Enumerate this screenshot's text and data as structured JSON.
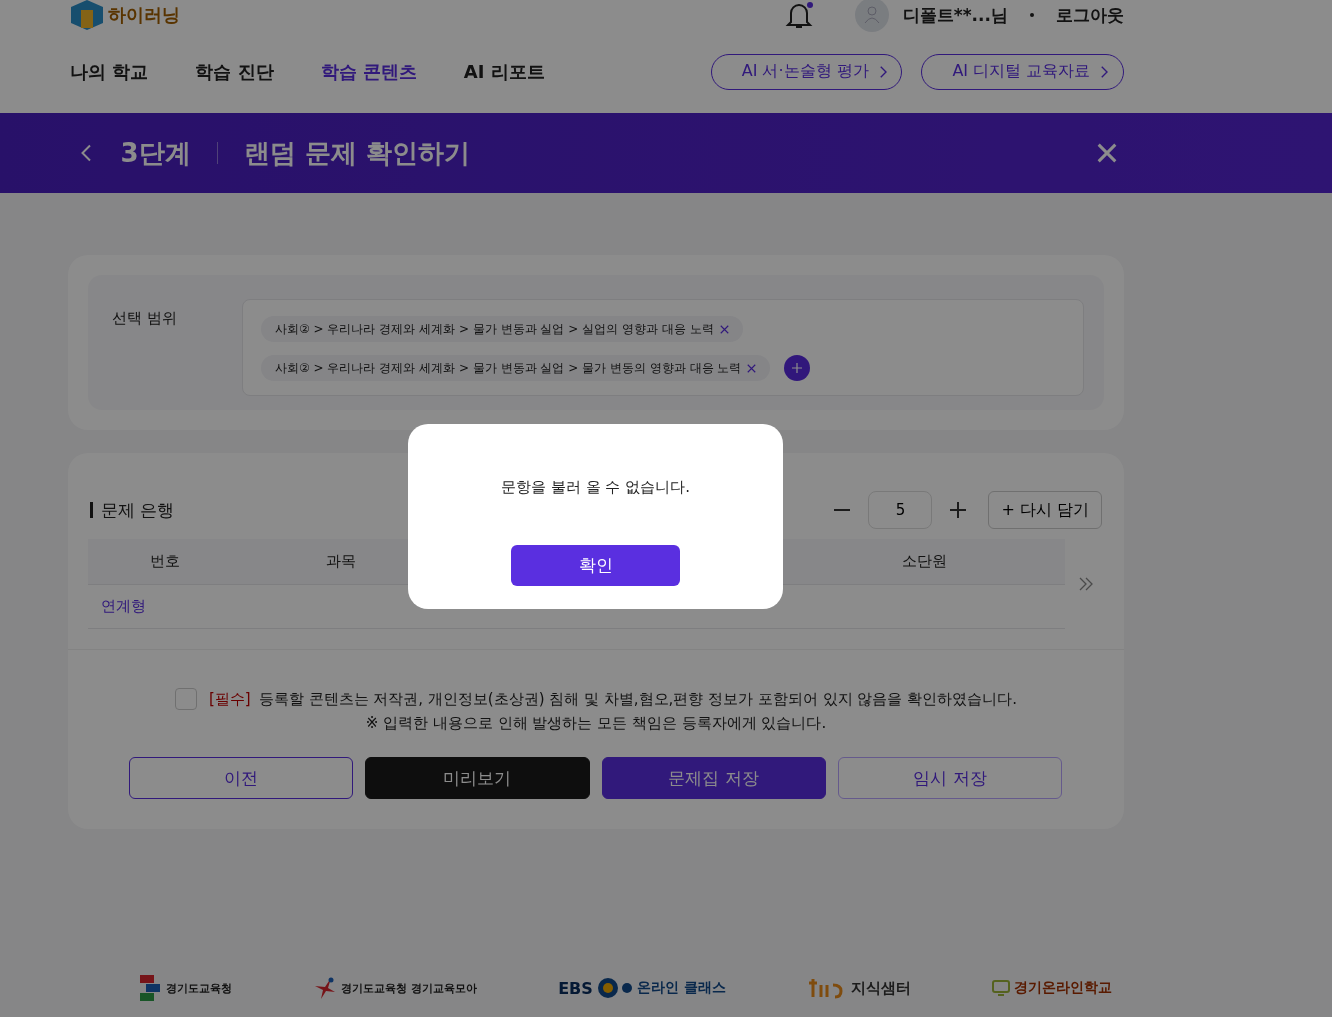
{
  "header": {
    "logo": "하이러닝",
    "user": {
      "name": "디폴트**...님",
      "logout": "로그아웃",
      "has_notification": true
    },
    "nav": [
      {
        "label": "나의 학교",
        "selected": false
      },
      {
        "label": "학습 진단",
        "selected": false
      },
      {
        "label": "학습 콘텐츠",
        "selected": true
      },
      {
        "label": "AI 리포트",
        "selected": false
      }
    ],
    "quick_links": [
      "AI 서·논술형 평가",
      "AI 디지털 교육자료"
    ]
  },
  "banner": {
    "step": "3단계",
    "title": "랜덤 문제 확인하기"
  },
  "range": {
    "label": "선택 범위",
    "chips": [
      "사회② > 우리나라 경제와 세계화 > 물가 변동과 실업 > 실업의 영향과 대응 노력",
      "사회② > 우리나라 경제와 세계화 > 물가 변동과 실업 > 물가 변동의 영향과 대응 노력"
    ]
  },
  "bank": {
    "title": "문제 은행",
    "count": "5",
    "reload": "+ 다시 담기",
    "columns": [
      "번호",
      "과목",
      "소단원"
    ],
    "rows": [
      {
        "type_label": "연계형"
      }
    ]
  },
  "consent": {
    "checked": false,
    "required": "[필수]",
    "text": "등록할 콘텐츠는 저작권, 개인정보(초상권) 침해 및 차별,혐오,편향 정보가 포함되어 있지 않음을 확인하였습니다.",
    "note": "※ 입력한 내용으로 인해 발생하는 모든 책임은 등록자에게 있습니다."
  },
  "actions": [
    {
      "label": "이전",
      "kind": "outline"
    },
    {
      "label": "미리보기",
      "kind": "dark"
    },
    {
      "label": "문제집 저장",
      "kind": "primary"
    },
    {
      "label": "임시 저장",
      "kind": "soft"
    }
  ],
  "footer": {
    "logos": [
      {
        "kind": "gyeonggi",
        "text": "경기도교육청"
      },
      {
        "kind": "moa",
        "text": "경기도교육청 경기교육모아"
      },
      {
        "kind": "ebs",
        "mark": "EBS",
        "text": "온라인 클래스"
      },
      {
        "kind": "jisik",
        "text": "지식샘터"
      },
      {
        "kind": "online",
        "text": "경기온라인학교"
      }
    ]
  },
  "dialog": {
    "message": "문항을 불러 올 수 없습니다.",
    "confirm": "확인"
  }
}
